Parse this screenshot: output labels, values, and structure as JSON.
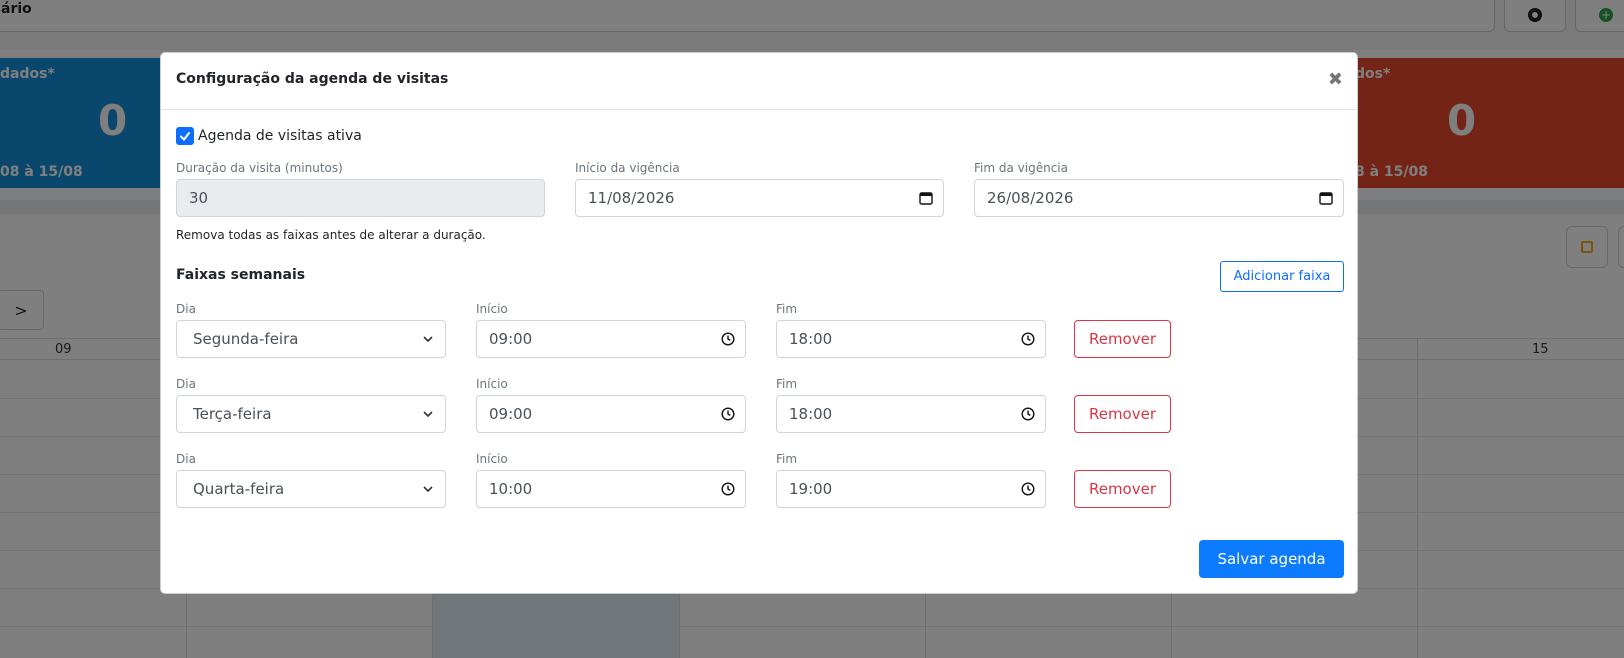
{
  "background": {
    "search_text": "ário",
    "card_left": {
      "title": "dados*",
      "value": "0",
      "range": "08 à 15/08"
    },
    "card_right": {
      "title": "dos*",
      "value": "0",
      "range": "8 à 15/08"
    },
    "nav_next": ">",
    "grid_head": {
      "left_day": "09",
      "right_day": "15"
    },
    "colors": {
      "blue_card": "#1390d8",
      "red_card": "#e8482c"
    }
  },
  "modal": {
    "title": "Configuração da agenda de visitas",
    "close_glyph": "✖",
    "active_checkbox": {
      "label": "Agenda de visitas ativa",
      "checked": true
    },
    "duration": {
      "label": "Duração da visita (minutos)",
      "value": "30",
      "helper": "Remova todas as faixas antes de alterar a duração."
    },
    "start_validity": {
      "label": "Início da vigência",
      "value": "11/08/2026"
    },
    "end_validity": {
      "label": "Fim da vigência",
      "value": "26/08/2026"
    },
    "weekly_section": {
      "title": "Faixas semanais",
      "add_label": "Adicionar faixa",
      "rows": [
        {
          "day_label": "Dia",
          "day": "Segunda-feira",
          "start_label": "Início",
          "start": "09:00",
          "end_label": "Fim",
          "end": "18:00",
          "remove_label": "Remover"
        },
        {
          "day_label": "Dia",
          "day": "Terça-feira",
          "start_label": "Início",
          "start": "09:00",
          "end_label": "Fim",
          "end": "18:00",
          "remove_label": "Remover"
        },
        {
          "day_label": "Dia",
          "day": "Quarta-feira",
          "start_label": "Início",
          "start": "10:00",
          "end_label": "Fim",
          "end": "19:00",
          "remove_label": "Remover"
        }
      ]
    },
    "save_label": "Salvar agenda",
    "colors": {
      "primary": "#0d7bff",
      "danger": "#dc3545"
    }
  }
}
